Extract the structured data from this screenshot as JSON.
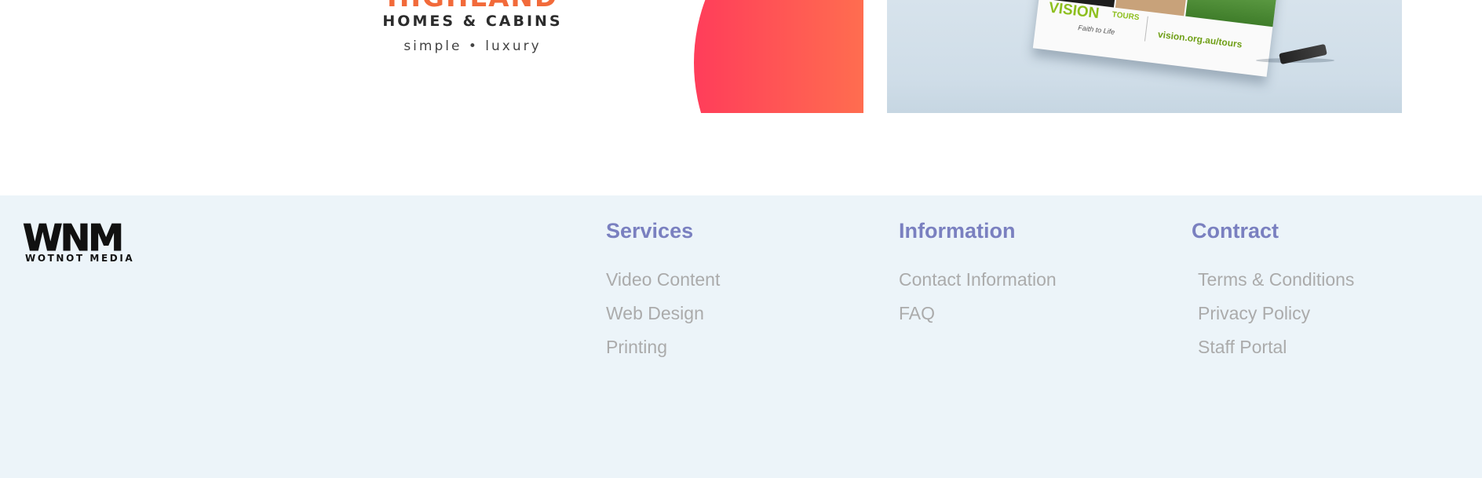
{
  "top": {
    "highland_logo": {
      "name": "HIGHLAND",
      "subtitle": "HOMES & CABINS",
      "tagline": "simple • luxury"
    },
    "brochure": {
      "brand": "VISION",
      "tours": "TOURS",
      "tagline": "Faith to Life",
      "url": "vision.org.au/tours"
    }
  },
  "footer": {
    "logo": {
      "mark": "WNM",
      "name": "WOTNOT MEDIA"
    },
    "columns": [
      {
        "heading": "Services",
        "links": [
          "Video Content",
          "Web Design",
          "Printing"
        ]
      },
      {
        "heading": "Information",
        "links": [
          "Contact Information",
          "FAQ"
        ]
      },
      {
        "heading": "Contract",
        "links": [
          "Terms & Conditions",
          "Privacy Policy",
          "Staff Portal"
        ]
      }
    ]
  },
  "colors": {
    "footer_bg": "#ecf4f9",
    "heading": "#7a80c0",
    "link": "#ababab",
    "highland_orange": "#f26a3a",
    "vision_green": "#8dbf1e"
  }
}
